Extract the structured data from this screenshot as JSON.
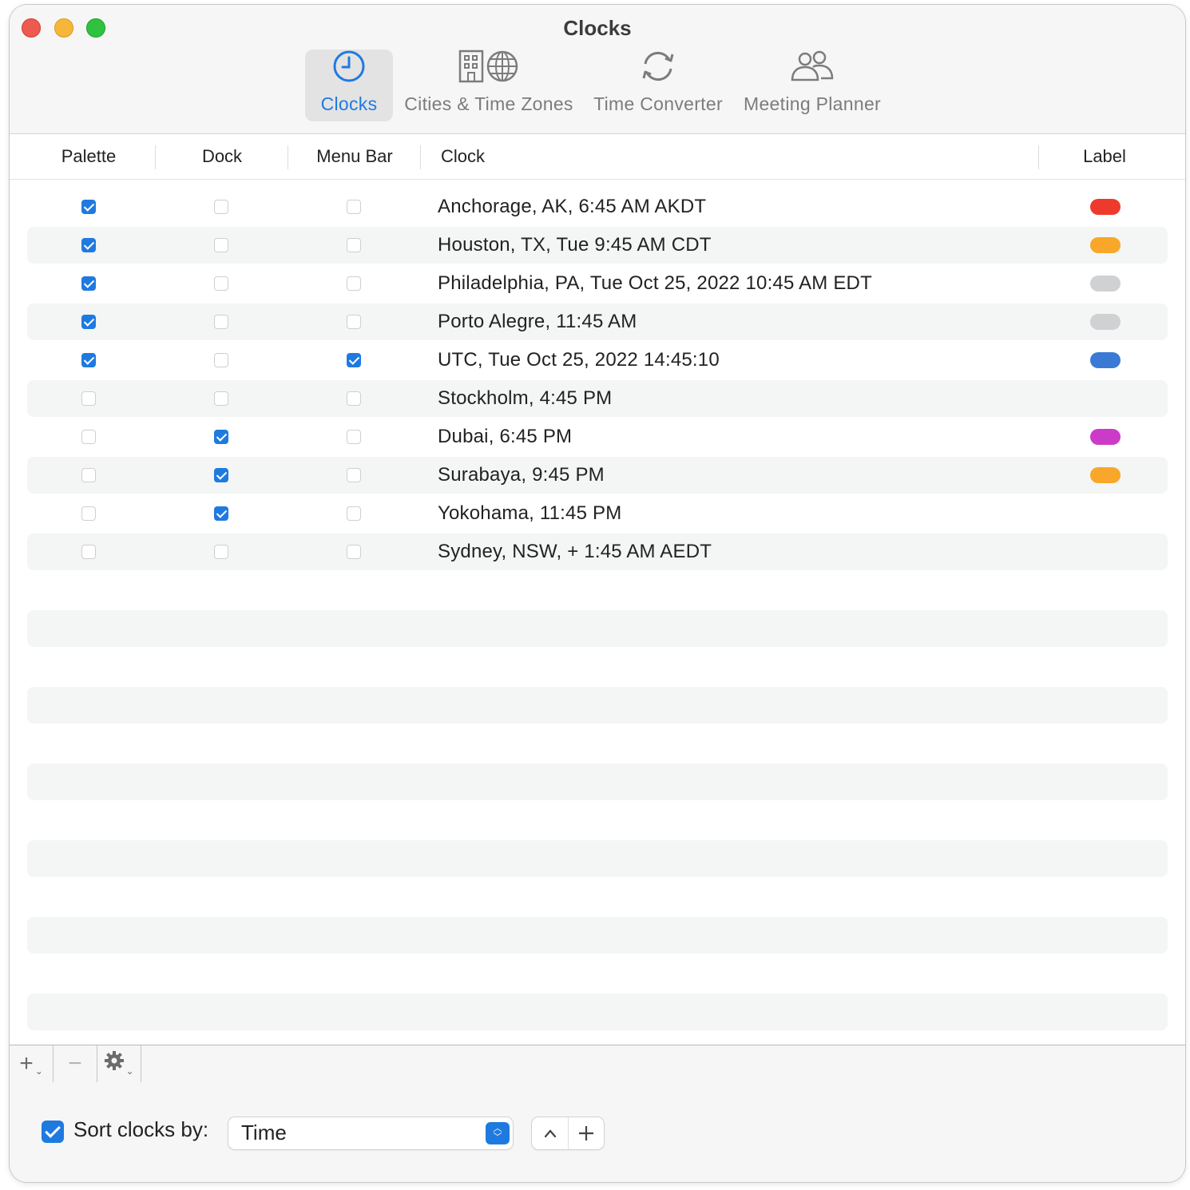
{
  "window": {
    "title": "Clocks"
  },
  "toolbar": {
    "tabs": [
      {
        "label": "Clocks",
        "icon": "clock-icon",
        "selected": true
      },
      {
        "label": "Cities & Time Zones",
        "icon": "building-globe-icon",
        "selected": false
      },
      {
        "label": "Time Converter",
        "icon": "sync-arrows-icon",
        "selected": false
      },
      {
        "label": "Meeting Planner",
        "icon": "people-icon",
        "selected": false
      }
    ]
  },
  "table": {
    "columns": [
      "Palette",
      "Dock",
      "Menu Bar",
      "Clock",
      "Label"
    ],
    "rows": [
      {
        "palette": true,
        "dock": false,
        "menubar": false,
        "clock": "Anchorage, AK, 6:45 AM AKDT",
        "label_color": "#ee3a2c"
      },
      {
        "palette": true,
        "dock": false,
        "menubar": false,
        "clock": "Houston, TX, Tue 9:45 AM CDT",
        "label_color": "#f8a72a"
      },
      {
        "palette": true,
        "dock": false,
        "menubar": false,
        "clock": "Philadelphia, PA, Tue Oct 25, 2022 10:45 AM EDT",
        "label_color": "#cfd1d3"
      },
      {
        "palette": true,
        "dock": false,
        "menubar": false,
        "clock": "Porto Alegre, 11:45 AM",
        "label_color": "#cfd1d3"
      },
      {
        "palette": true,
        "dock": false,
        "menubar": true,
        "clock": "UTC, Tue Oct 25, 2022 14:45:10",
        "label_color": "#3a7ad5"
      },
      {
        "palette": false,
        "dock": false,
        "menubar": false,
        "clock": "Stockholm, 4:45 PM",
        "label_color": null
      },
      {
        "palette": false,
        "dock": true,
        "menubar": false,
        "clock": "Dubai, 6:45 PM",
        "label_color": "#cc3bc8"
      },
      {
        "palette": false,
        "dock": true,
        "menubar": false,
        "clock": "Surabaya, 9:45 PM",
        "label_color": "#f8a72a"
      },
      {
        "palette": false,
        "dock": true,
        "menubar": false,
        "clock": "Yokohama, 11:45 PM",
        "label_color": null
      },
      {
        "palette": false,
        "dock": false,
        "menubar": false,
        "clock": "Sydney, NSW, + 1:45 AM AEDT",
        "label_color": null
      }
    ]
  },
  "bottom_bar": {
    "add": "+",
    "remove": "−",
    "action": "gear-icon"
  },
  "footer": {
    "sort_enabled": true,
    "sort_label": "Sort clocks by:",
    "sort_value": "Time"
  },
  "colors": {
    "accent": "#1f7ae0"
  }
}
